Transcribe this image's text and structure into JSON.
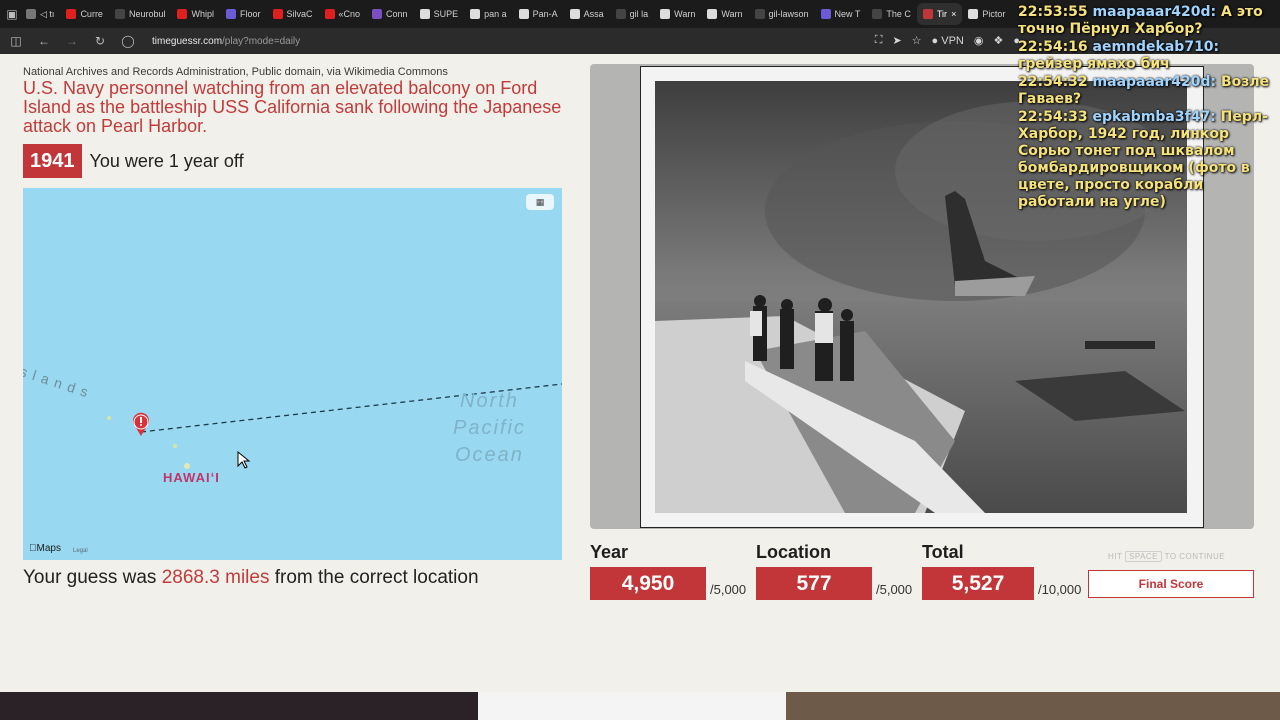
{
  "browser": {
    "tabs": [
      {
        "label": "◁ tı",
        "color": "#777777",
        "active": false
      },
      {
        "label": "Curre",
        "color": "#e02020",
        "active": false
      },
      {
        "label": "Neurobul",
        "color": "#444444",
        "active": false
      },
      {
        "label": "Whipl",
        "color": "#e02020",
        "active": false
      },
      {
        "label": "Floor",
        "color": "#6b5bd6",
        "active": false
      },
      {
        "label": "SilvaC",
        "color": "#e02020",
        "active": false
      },
      {
        "label": "«Cno",
        "color": "#e02020",
        "active": false
      },
      {
        "label": "Conn",
        "color": "#7b4fbf",
        "active": false
      },
      {
        "label": "SUPE",
        "color": "#dddddd",
        "active": false
      },
      {
        "label": "pan a",
        "color": "#dddddd",
        "active": false
      },
      {
        "label": "Pan-A",
        "color": "#dddddd",
        "active": false
      },
      {
        "label": "Assa",
        "color": "#dddddd",
        "active": false
      },
      {
        "label": "gil la",
        "color": "#444444",
        "active": false
      },
      {
        "label": "Warn",
        "color": "#dddddd",
        "active": false
      },
      {
        "label": "Warn",
        "color": "#dddddd",
        "active": false
      },
      {
        "label": "gil-lawson",
        "color": "#444444",
        "active": false
      },
      {
        "label": "New T",
        "color": "#6b5bd6",
        "active": false
      },
      {
        "label": "The C",
        "color": "#444444",
        "active": false
      },
      {
        "label": "Tir",
        "color": "#c2363a",
        "active": true
      },
      {
        "label": "Pictor",
        "color": "#dddddd",
        "active": false
      }
    ],
    "url_host": "timeguessr.com",
    "url_path": "/play?mode=daily",
    "vpn_label": "VPN"
  },
  "round": {
    "credit": "National Archives and Records Administration, Public domain, via Wikimedia Commons",
    "caption": "U.S. Navy personnel watching from an elevated balcony on Ford Island as the battleship USS California sank following the Japanese attack on Pearl Harbor.",
    "year": "1941",
    "year_result": "You were 1 year off",
    "guess_prefix": "Your guess was",
    "guess_distance": "2868.3 miles",
    "guess_suffix": "from the correct location"
  },
  "map": {
    "ocean_label_line1": "North",
    "ocean_label_line2": "Pacific",
    "ocean_label_line3": "Ocean",
    "islands_label": "slands",
    "hawaii_label": "HAWAIʻI",
    "maps_logo": "Maps",
    "legal_label": "Legal",
    "water_color": "#99d8f1",
    "pin_color": "#d8333a",
    "toggle_icon": "map-toggle-icon"
  },
  "scores": {
    "year_title": "Year",
    "year_value": "4,950",
    "year_max": "/5,000",
    "location_title": "Location",
    "location_value": "577",
    "location_max": "/5,000",
    "total_title": "Total",
    "total_value": "5,527",
    "total_max": "/10,000",
    "hint_prefix": "HIT",
    "hint_key": "SPACE",
    "hint_suffix": "TO CONTINUE",
    "final_button": "Final Score",
    "accent_color": "#c2363a"
  },
  "chat": {
    "messages": [
      {
        "time": "22:53:55",
        "user": "maapaaar420d:",
        "text": "А это точно Пёрнул Харбор?"
      },
      {
        "time": "22:54:16",
        "user": "aemndekab710:",
        "text": "грейзер ямахо бич"
      },
      {
        "time": "22:54:32",
        "user": "maapaaar420d:",
        "text": "Возле Гаваев?"
      },
      {
        "time": "22:54:33",
        "user": "epkabmba3f47:",
        "text": "Перл-Харбор, 1942 год, линкор Сорью тонет под шквалом бомбардировщиком (фото в цвете, просто корабли работали на угле)"
      }
    ]
  }
}
